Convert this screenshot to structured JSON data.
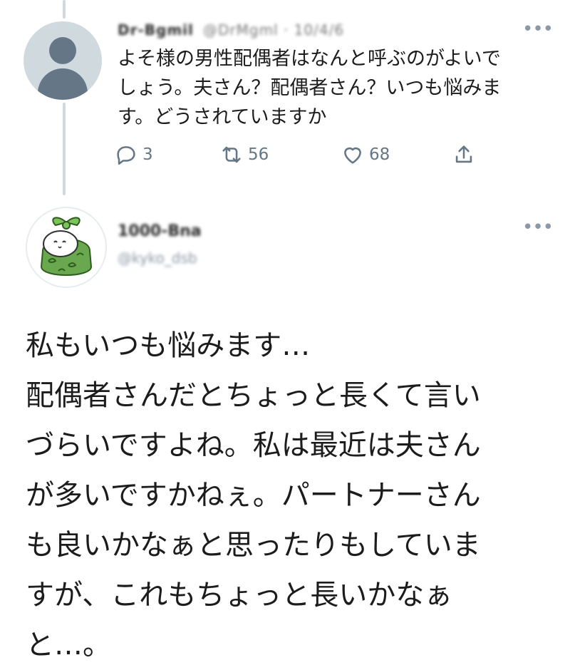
{
  "tweet1": {
    "author_name": "Dr-Bgmil",
    "author_handle": "@DrMgml · 10/4/6",
    "text_lines": [
      "よそ様の男性配偶者はなんと呼ぶのがよいで",
      "しょう。夫さん？配偶者さん？いつも悩みま",
      "す。どうされていますか"
    ],
    "reply_count": "3",
    "retweet_count": "56",
    "like_count": "68",
    "more_label": "•••"
  },
  "tweet2": {
    "author_name": "1000-Bna",
    "author_handle": "@kyko_dsb",
    "more_label": "•••",
    "text_lines": [
      "私もいつも悩みます…",
      "配偶者さんだとちょっと長くて言い",
      "づらいですよね。私は最近は夫さん",
      "が多いですかねぇ。パートナーさん",
      "も良いかなぁと思ったりもしていま",
      "すが、これもちょっと長いかなぁ",
      "と…。"
    ]
  },
  "colors": {
    "icon_gray": "#657786",
    "thread_line": "#cfd9de",
    "mascot_green": "#6aa84f",
    "text": "#1c1c1c"
  },
  "icons": [
    "reply-icon",
    "retweet-icon",
    "like-icon",
    "share-icon",
    "more-icon",
    "default-avatar-icon",
    "mascot-avatar-icon"
  ]
}
